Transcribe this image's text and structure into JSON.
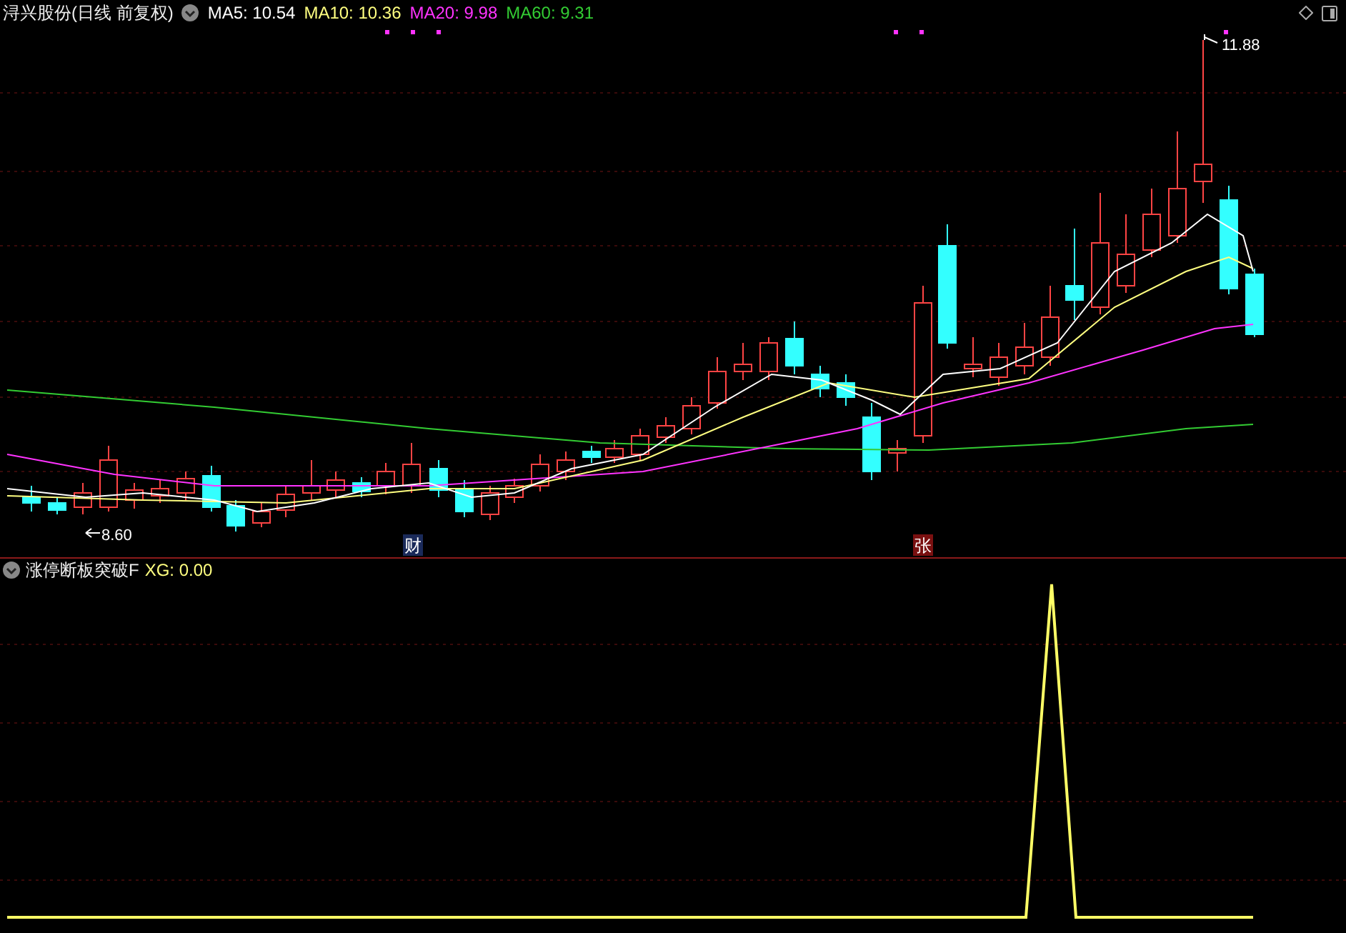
{
  "main_panel": {
    "title": "浔兴股份(日线 前复权)",
    "indicators": [
      {
        "label": "MA5: 10.54",
        "color": "#ffffff"
      },
      {
        "label": "MA10: 10.36",
        "color": "#ffff80"
      },
      {
        "label": "MA20: 9.98",
        "color": "#ff33ff"
      },
      {
        "label": "MA60: 9.31",
        "color": "#33cc33"
      }
    ],
    "high_label": "11.88",
    "low_label": "8.60",
    "event_markers": [
      {
        "text": "财",
        "kind": "finance"
      },
      {
        "text": "张",
        "kind": "limit"
      }
    ]
  },
  "sub_panel": {
    "title": "涨停断板突破F",
    "reading": "XG: 0.00"
  }
}
